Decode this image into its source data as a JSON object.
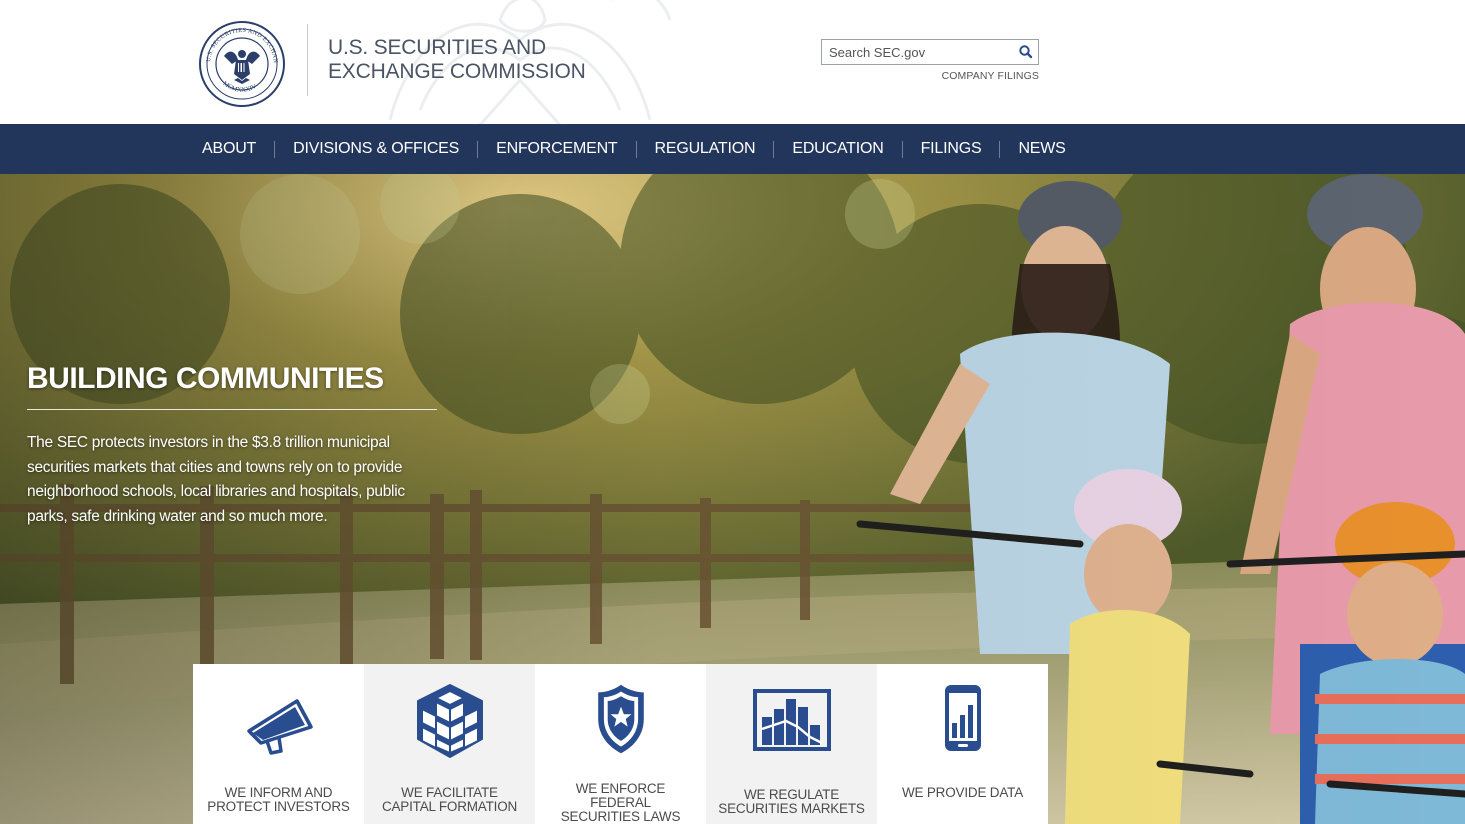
{
  "header": {
    "agency_line1": "U.S. SECURITIES AND",
    "agency_line2": "EXCHANGE COMMISSION",
    "seal": {
      "icon": "sec-seal-icon",
      "text": "U.S. SECURITIES AND EXCHANGE COMMISSION · MCMXXXIV"
    },
    "watermark_icon": "eagle-watermark-icon"
  },
  "search": {
    "placeholder": "Search SEC.gov",
    "value": "",
    "button_icon": "search-icon"
  },
  "company_filings_label": "COMPANY FILINGS",
  "nav": {
    "items": [
      {
        "label": "ABOUT"
      },
      {
        "label": "DIVISIONS & OFFICES"
      },
      {
        "label": "ENFORCEMENT"
      },
      {
        "label": "REGULATION"
      },
      {
        "label": "EDUCATION"
      },
      {
        "label": "FILINGS"
      },
      {
        "label": "NEWS"
      }
    ]
  },
  "hero": {
    "title": "BUILDING COMMUNITIES",
    "body": "The SEC protects investors in the $3.8 trillion municipal securities markets that cities and towns rely on to provide neighborhood schools, local libraries and hospitals, public parks, safe drinking water and so much more."
  },
  "tiles": [
    {
      "line1": "WE INFORM AND",
      "line2": "PROTECT INVESTORS",
      "icon": "megaphone-icon"
    },
    {
      "line1": "WE FACILITATE",
      "line2": "CAPITAL FORMATION",
      "icon": "cubes-icon"
    },
    {
      "line1": "WE ENFORCE FEDERAL",
      "line2": "SECURITIES LAWS",
      "icon": "shield-star-icon"
    },
    {
      "line1": "WE REGULATE",
      "line2": "SECURITIES MARKETS",
      "icon": "bar-chart-icon"
    },
    {
      "line1": "WE PROVIDE DATA",
      "line2": "",
      "icon": "mobile-data-icon"
    }
  ],
  "colors": {
    "nav_bg": "#22355a",
    "icon_blue": "#2a4d8f",
    "tile_text": "#4b4b4b"
  }
}
